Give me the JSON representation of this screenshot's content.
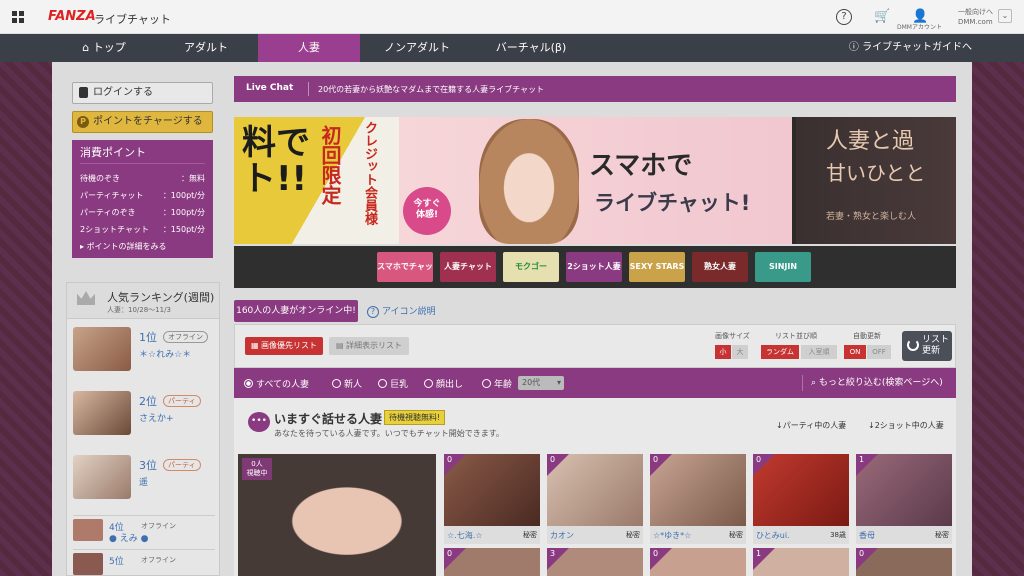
{
  "topbar": {
    "brand": "FANZA",
    "service": "ライブチャット",
    "account_icon_label": "DMMアカウント",
    "account_line1": "一般向けへ",
    "account_line2": "DMM.com"
  },
  "nav": {
    "items": [
      {
        "label": "トップ",
        "icon": "home-icon"
      },
      {
        "label": "アダルト"
      },
      {
        "label": "人妻",
        "active": true
      },
      {
        "label": "ノンアダルト"
      },
      {
        "label": "バーチャル(β)"
      }
    ],
    "guide": "ライブチャットガイドへ"
  },
  "sidebar": {
    "login": "ログインする",
    "charge": "ポイントをチャージする",
    "points": {
      "title": "消費ポイント",
      "rows": [
        {
          "label": "待機のぞき",
          "value": "：無料"
        },
        {
          "label": "パーティチャット",
          "value": "：100pt/分"
        },
        {
          "label": "パーティのぞき",
          "value": "：100pt/分"
        },
        {
          "label": "2ショットチャット",
          "value": "：150pt/分"
        }
      ],
      "more": "ポイントの詳細をみる"
    },
    "ranking": {
      "title": "人気ランキング(週間)",
      "period": "人妻：10/28〜11/3",
      "top": [
        {
          "pos": "1位",
          "status": "オフライン",
          "name": "＊☆れみ☆＊"
        },
        {
          "pos": "2位",
          "status": "パーティ",
          "name": "さえか+"
        },
        {
          "pos": "3位",
          "status": "パーティ",
          "name": "遥"
        }
      ],
      "rest": [
        {
          "pos": "4位",
          "status": "オフライン",
          "name": "● えみ ●"
        },
        {
          "pos": "5位",
          "status": "オフライン",
          "name": ""
        }
      ]
    }
  },
  "main": {
    "livechat_label": "Live Chat",
    "livechat_desc": "20代の若妻から妖艶なマダムまで在籍する人妻ライブチャット",
    "banner": {
      "left_big": "料で\nト!!",
      "left_limited": "初回限定",
      "left_card": "クレジット会員様",
      "center_badge": "今すぐ\n体感!",
      "center_line1": "スマホで",
      "center_line2": "ライブチャット!",
      "right_line1": "人妻と過",
      "right_line2": "甘いひとと",
      "right_line3": "若妻・熟女と楽しむ人"
    },
    "thumbs": [
      {
        "label": "スマホでチャット",
        "color": "#d8577f"
      },
      {
        "label": "人妻チャット",
        "color": "#a03050"
      },
      {
        "label": "モクゴー",
        "color": "#e6e0b0"
      },
      {
        "label": "2ショット人妻割",
        "color": "#8a3a80"
      },
      {
        "label": "SEXY STARS",
        "color": "#c9a24a"
      },
      {
        "label": "熟女人妻",
        "color": "#7a2a2a"
      },
      {
        "label": "SINJIN",
        "color": "#3a9a8a"
      }
    ],
    "online_count": "160人の人妻がオンライン中!",
    "icon_help": "アイコン説明",
    "list_tabs": {
      "image": "画像優先リスト",
      "detail": "詳細表示リスト"
    },
    "controls": {
      "size_label": "画像サイズ",
      "size_small": "小",
      "size_large": "大",
      "order_label": "リスト並び順",
      "order_random": "ランダム",
      "order_login": "入室順",
      "auto_label": "自動更新",
      "auto_on": "ON",
      "auto_off": "OFF",
      "refresh": "リスト\n更新"
    },
    "filters": [
      {
        "label": "すべての人妻",
        "selected": true
      },
      {
        "label": "新人"
      },
      {
        "label": "巨乳"
      },
      {
        "label": "顔出し"
      },
      {
        "label": "年齢"
      }
    ],
    "age_value": "20代",
    "narrow": "もっと絞り込む(検索ページへ)",
    "talk": {
      "title": "いますぐ話せる人妻",
      "badge": "待機視聴無料!",
      "sub": "あなたを待っている人妻です。いつでもチャット開始できます。",
      "jump_party": "パーティ中の人妻",
      "jump_2shot": "2ショット中の人妻"
    },
    "big_card": {
      "count": "0人",
      "status": "視聴中"
    },
    "cards": [
      {
        "count": "0",
        "name": "☆.七海.☆",
        "status": "秘密",
        "color": "#6a3a2e"
      },
      {
        "count": "0",
        "name": "カオン",
        "status": "秘密",
        "color": "#c9a48a"
      },
      {
        "count": "0",
        "name": "☆*ゆき*☆",
        "status": "秘密",
        "color": "#a9877a"
      },
      {
        "count": "0",
        "name": "ひとみui.",
        "status": "38歳",
        "color": "#b9342a"
      },
      {
        "count": "1",
        "name": "香母",
        "status": "秘密",
        "color": "#7a4a5a"
      }
    ],
    "cards_row2": [
      "0",
      "3",
      "0",
      "1",
      "0"
    ]
  }
}
